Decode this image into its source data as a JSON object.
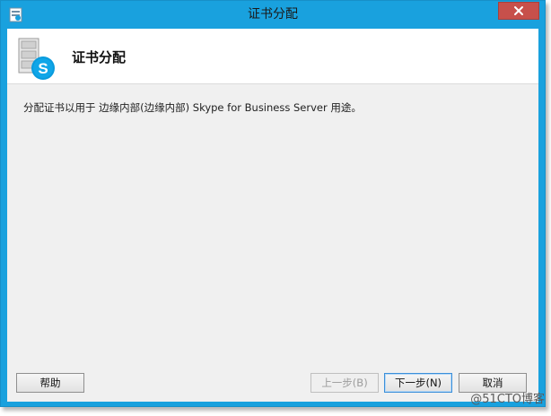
{
  "window": {
    "title": "证书分配",
    "close_icon": "close-icon",
    "colors": {
      "frame": "#19a1de",
      "close": "#c7504b",
      "client": "#f0f0f0"
    }
  },
  "header": {
    "title": "证书分配",
    "icon": "server-skype-icon"
  },
  "content": {
    "description": "分配证书以用于 边缘内部(边缘内部) Skype for Business Server 用途。"
  },
  "buttons": {
    "help": "帮助",
    "back": "上一步(B)",
    "next": "下一步(N)",
    "cancel": "取消"
  },
  "watermark": "@51CTO博客"
}
